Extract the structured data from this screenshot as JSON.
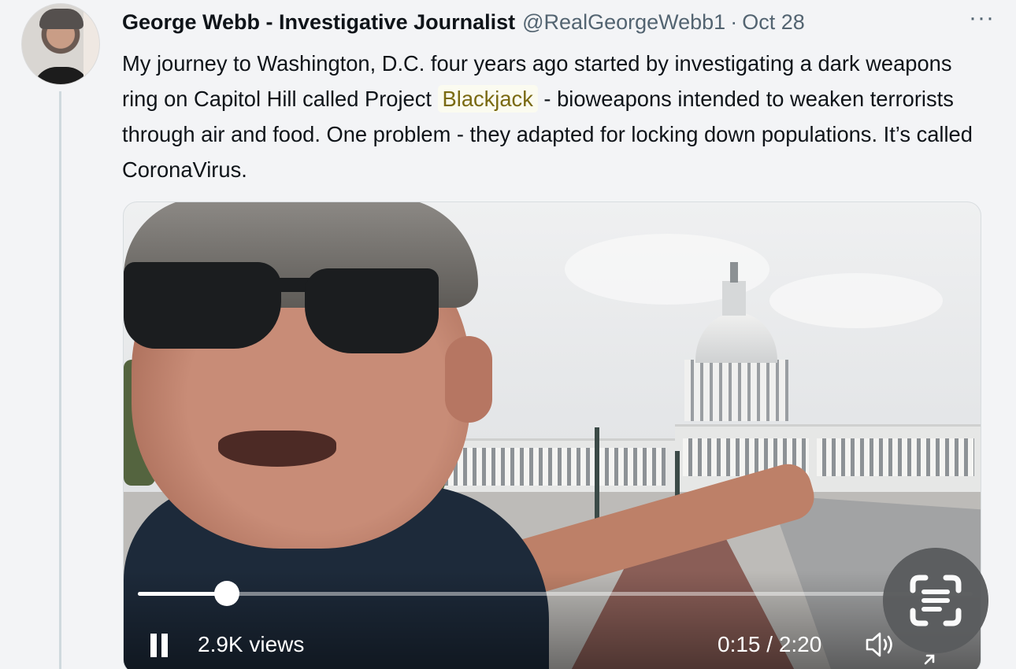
{
  "tweet": {
    "author_name": "George Webb - Investigative Journalist",
    "handle": "@RealGeorgeWebb1",
    "separator": "·",
    "date": "Oct 28",
    "more_label": "···",
    "text_before": "My journey to Washington, D.C. four years ago started by investigating a dark weapons ring on Capitol Hill called Project ",
    "highlighted_word": "Blackjack",
    "text_after": " - bioweapons intended to weaken terrorists through air and food. One problem - they adapted for locking down populations. It’s called CoronaVirus."
  },
  "video": {
    "views": "2.9K views",
    "time": "0:15 / 2:20",
    "progress_fraction": 0.107
  },
  "icons": {
    "avatar": "author-avatar",
    "more": "more-icon",
    "pause": "pause-icon",
    "volume": "speaker-icon",
    "expand": "collapse-arrows-icon",
    "scan": "text-scan-icon"
  },
  "colors": {
    "highlight_text": "#7a6a12",
    "secondary_text": "#536471",
    "thread_line": "#cfd9de"
  }
}
